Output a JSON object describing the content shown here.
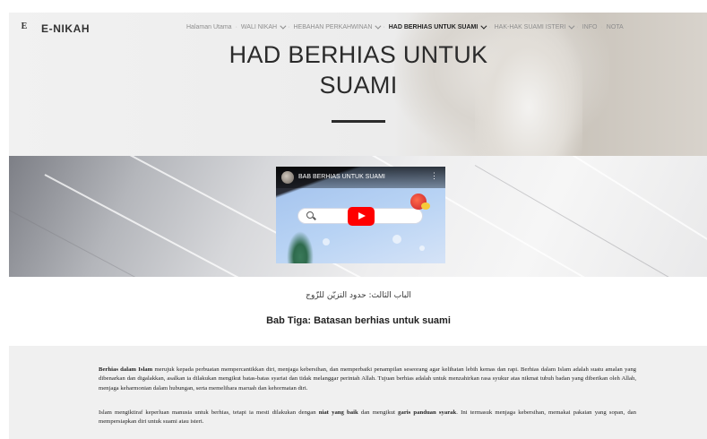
{
  "header": {
    "brand": "E-NIKAH",
    "logo_mark": "E",
    "nav": [
      {
        "label": "Halaman Utama",
        "dropdown": false,
        "active": false
      },
      {
        "label": "WALI NIKAH",
        "dropdown": true,
        "active": false
      },
      {
        "label": "HEBAHAN PERKAHWINAN",
        "dropdown": true,
        "active": false
      },
      {
        "label": "HAD BERHIAS UNTUK SUAMI",
        "dropdown": true,
        "active": true
      },
      {
        "label": "HAK-HAK SUAMI ISTERI",
        "dropdown": true,
        "active": false
      },
      {
        "label": "INFO",
        "dropdown": false,
        "active": false
      },
      {
        "label": "NOTA",
        "dropdown": false,
        "active": false
      }
    ]
  },
  "hero": {
    "title_line1": "HAD BERHIAS UNTUK",
    "title_line2": "SUAMI"
  },
  "video": {
    "title": "BAB BERHIAS UNTUK SUAMI",
    "menu_glyph": "⋮"
  },
  "section": {
    "arabic_heading": "الباب الثالث: حدود التزيّن للزّوج",
    "heading": "Bab Tiga: Batasan berhias untuk suami"
  },
  "article": {
    "p1": {
      "lead": "Berhias dalam Islam",
      "body": " merujuk kepada perbuatan mempercantikkan diri, menjaga kebersihan, dan memperbaiki penampilan seseorang agar kelihatan lebih kemas dan rapi. Berhias dalam Islam adalah suatu amalan yang dibenarkan dan digalakkan, asalkan ia dilakukan mengikut batas-batas syariat dan tidak melanggar perintah Allah. Tujuan berhias adalah untuk menzahirkan rasa syukur atas nikmat tubuh badan yang diberikan oleh Allah, menjaga keharmonian dalam hubungan, serta memelihara maruah dan kehormatan diri."
    },
    "p2": {
      "t1": "Islam mengiktiraf keperluan manusia untuk berhias, tetapi ia mesti dilakukan dengan ",
      "b1": "niat yang baik",
      "t2": " dan mengikut ",
      "b2": "garis panduan syarak",
      "t3": ". Ini termasuk menjaga kebersihan, memakai pakaian yang sopan, dan mempersiapkan diri untuk suami atau isteri."
    }
  },
  "colors": {
    "accent_dark": "#2b2b2b",
    "youtube_red": "#ff0000",
    "article_bg": "#f0f0f0"
  }
}
